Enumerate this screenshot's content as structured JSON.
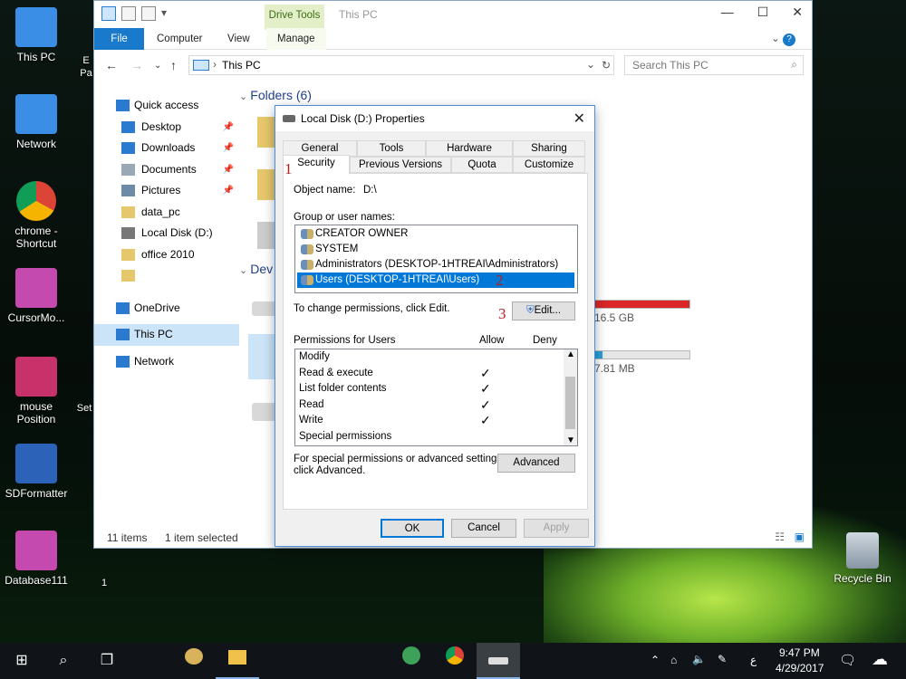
{
  "desktop": {
    "icons": [
      "This PC",
      "Network",
      "chrome - Shortcut",
      "CursorMo...",
      "mouse Position",
      "SDFormatter",
      "Database111"
    ],
    "right_icon": "Recycle Bin",
    "partial": [
      "E",
      "Pa",
      "Set",
      "1"
    ]
  },
  "explorer": {
    "title": "This PC",
    "drive_tools": "Drive Tools",
    "ribbon_tabs": [
      "File",
      "Computer",
      "View",
      "Manage"
    ],
    "address": "This PC",
    "search_placeholder": "Search This PC",
    "sidebar": [
      {
        "label": "Quick access",
        "icon": "star-icon"
      },
      {
        "label": "Desktop",
        "icon": "desktop-icon",
        "pinned": true
      },
      {
        "label": "Downloads",
        "icon": "download-icon",
        "pinned": true
      },
      {
        "label": "Documents",
        "icon": "documents-icon",
        "pinned": true
      },
      {
        "label": "Pictures",
        "icon": "pictures-icon",
        "pinned": true
      },
      {
        "label": "data_pc",
        "icon": "folder-icon"
      },
      {
        "label": "Local Disk (D:)",
        "icon": "drive-icon"
      },
      {
        "label": "office 2010",
        "icon": "folder-icon"
      },
      {
        "label": "",
        "icon": "folder-icon"
      },
      {
        "label": "OneDrive",
        "icon": "onedrive-icon"
      },
      {
        "label": "This PC",
        "icon": "pc-icon"
      },
      {
        "label": "Network",
        "icon": "network-icon"
      }
    ],
    "folders_heading": "Folders (6)",
    "devices_heading": "Dev",
    "drive1_free": "16.5 GB",
    "drive2_free": "7.81 MB",
    "status_items": "11 items",
    "status_selected": "1 item selected"
  },
  "dialog": {
    "title": "Local Disk (D:) Properties",
    "tabs_row1": [
      "General",
      "Tools",
      "Hardware",
      "Sharing"
    ],
    "tabs_row2": [
      "Security",
      "Previous Versions",
      "Quota",
      "Customize"
    ],
    "object_label": "Object name:",
    "object_value": "D:\\",
    "group_label": "Group or user names:",
    "users": [
      "CREATOR OWNER",
      "SYSTEM",
      "Administrators (DESKTOP-1HTREAI\\Administrators)",
      "Users (DESKTOP-1HTREAI\\Users)"
    ],
    "change_text": "To change permissions, click Edit.",
    "edit_button": "Edit...",
    "perm_header": "Permissions for Users",
    "allow": "Allow",
    "deny": "Deny",
    "permissions": [
      {
        "name": "Modify",
        "allow": false
      },
      {
        "name": "Read & execute",
        "allow": true
      },
      {
        "name": "List folder contents",
        "allow": true
      },
      {
        "name": "Read",
        "allow": true
      },
      {
        "name": "Write",
        "allow": true
      },
      {
        "name": "Special permissions",
        "allow": false
      }
    ],
    "advanced_text_1": "For special permissions or advanced settings,",
    "advanced_text_2": "click Advanced.",
    "advanced_button": "Advanced",
    "ok": "OK",
    "cancel": "Cancel",
    "apply": "Apply",
    "annotations": [
      "1",
      "2",
      "3"
    ]
  },
  "taskbar": {
    "time": "9:47 PM",
    "date": "4/29/2017",
    "lang": "ع"
  }
}
